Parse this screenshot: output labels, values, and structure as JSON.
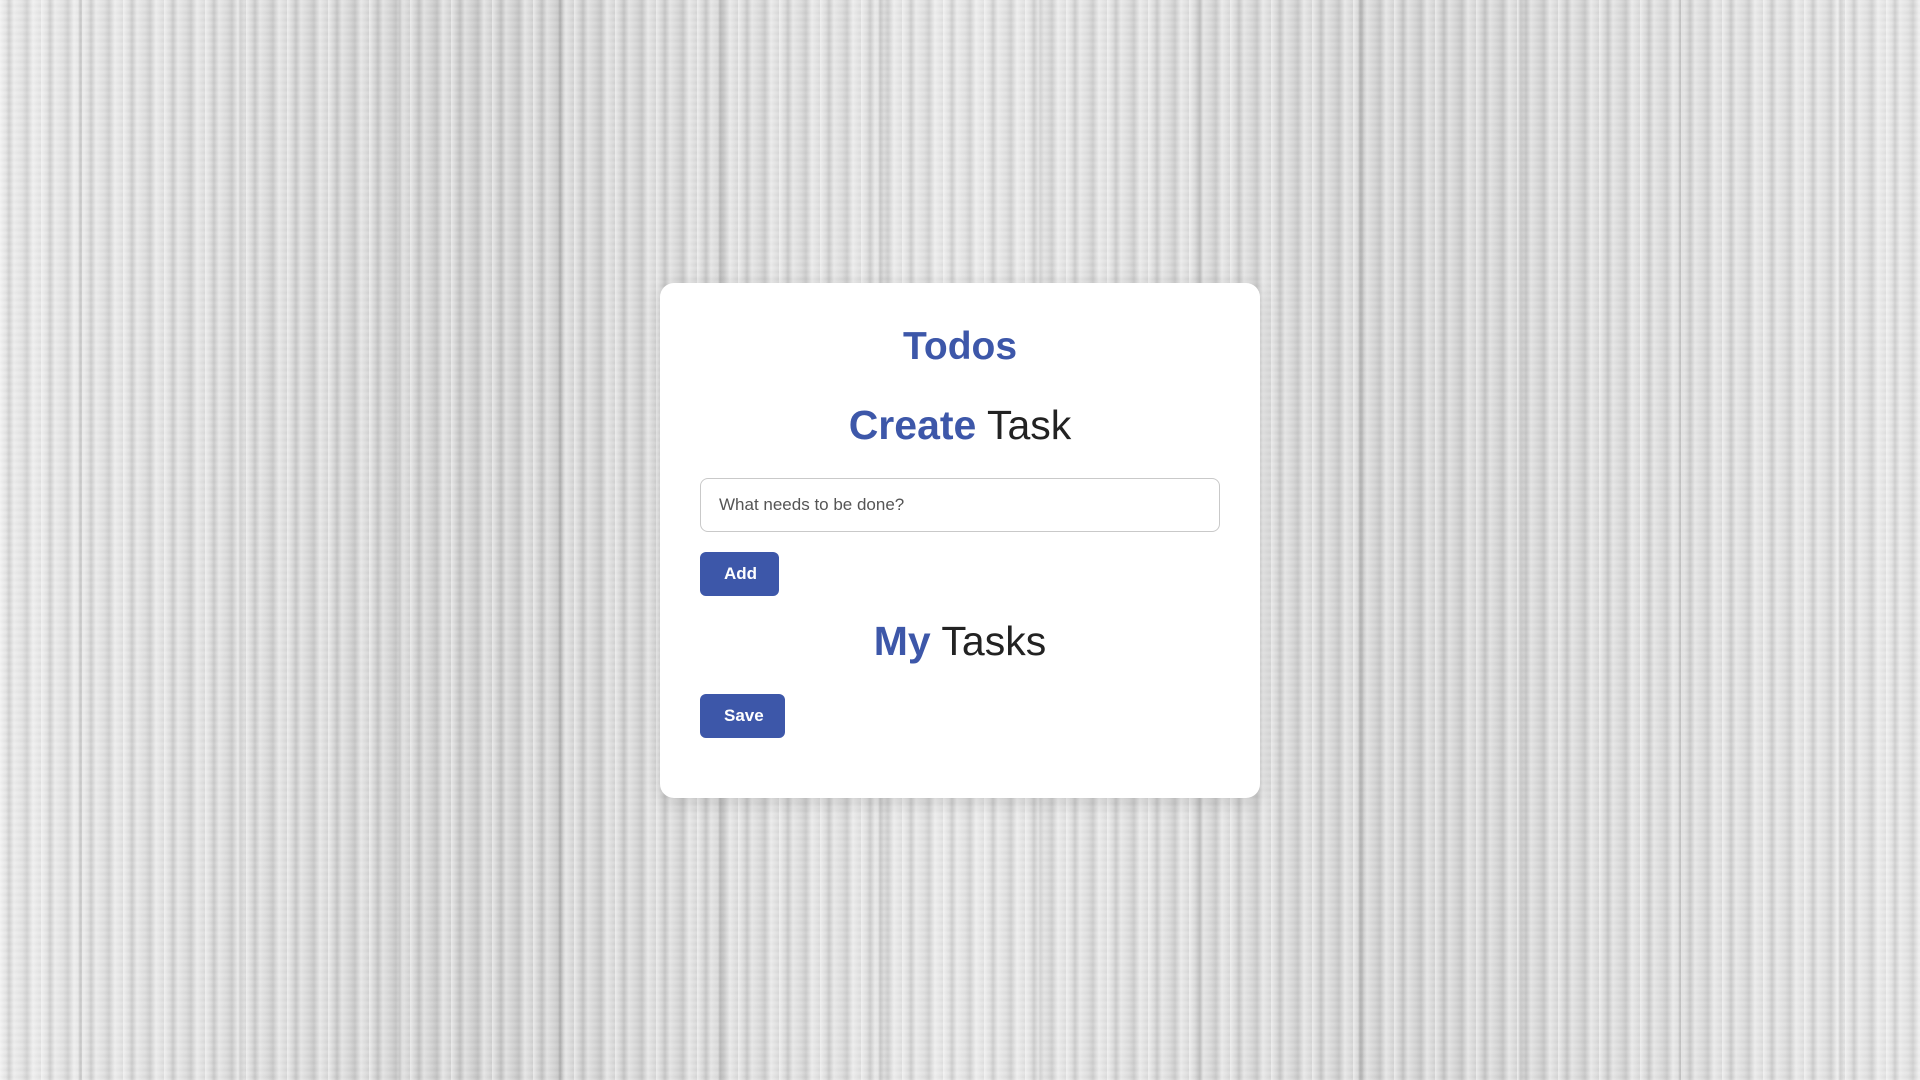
{
  "app": {
    "title": "Todos",
    "accent_color": "#3d57a9"
  },
  "create_section": {
    "title_accent": "Create",
    "title_rest": " Task",
    "input": {
      "placeholder": "What needs to be done?",
      "value": ""
    },
    "add_label": "Add"
  },
  "tasks_section": {
    "title_accent": "My",
    "title_rest": " Tasks",
    "tasks": [],
    "save_label": "Save"
  }
}
